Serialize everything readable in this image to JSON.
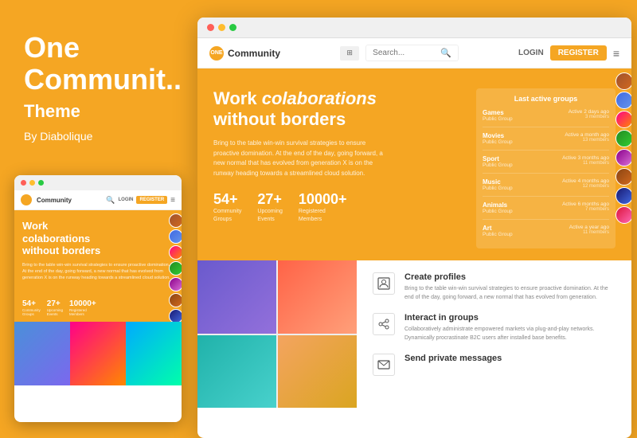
{
  "left": {
    "title_line1": "One",
    "title_line2": "Communit..",
    "subtitle": "Theme",
    "by": "By Diabolique"
  },
  "browser": {
    "dots": [
      "red",
      "yellow",
      "green"
    ]
  },
  "nav": {
    "logo_initial": "ONE",
    "logo_text": "Community",
    "search_placeholder": "Search...",
    "login": "LOGIN",
    "register": "REGISTER"
  },
  "hero": {
    "title_bold": "Work",
    "title_italic": "colaborations",
    "title_line2": "without borders",
    "description": "Bring to the table win-win survival strategies to ensure proactive domination. At the end of the day, going forward, a new normal that has evolved from generation X is on the runway heading towards a streamlined cloud solution.",
    "stats": [
      {
        "num": "54+",
        "label_line1": "Community",
        "label_line2": "Groups"
      },
      {
        "num": "27+",
        "label_line1": "Upcoming",
        "label_line2": "Events"
      },
      {
        "num": "10000+",
        "label_line1": "Registered",
        "label_line2": "Members"
      }
    ]
  },
  "groups_panel": {
    "title": "Last active groups",
    "groups": [
      {
        "name": "Games",
        "type": "Public Group",
        "activity": "Active 2 days ago",
        "members": "3 members"
      },
      {
        "name": "Movies",
        "type": "Public Group",
        "activity": "Active a month ago",
        "members": "13 members"
      },
      {
        "name": "Sport",
        "type": "Public Group",
        "activity": "Active 3 months ago",
        "members": "11 members"
      },
      {
        "name": "Music",
        "type": "Public Group",
        "activity": "Active 4 months ago",
        "members": "12 members"
      },
      {
        "name": "Animals",
        "type": "Public Group",
        "activity": "Active 6 months ago",
        "members": "7 members"
      },
      {
        "name": "Art",
        "type": "Public Group",
        "activity": "Active a year ago",
        "members": "11 members"
      }
    ]
  },
  "features": [
    {
      "icon": "👤",
      "title": "Create profiles",
      "desc": "Bring to the table win-win survival strategies to ensure proactive domination. At the end of the day, going forward, a new normal that has evolved from generation."
    },
    {
      "icon": "🔗",
      "title": "Interact in groups",
      "desc": "Collaboratively administrate empowered markets via plug-and-play networks. Dynamically procrastinate B2C users after installed base benefits."
    },
    {
      "icon": "✉",
      "title": "Send private messages",
      "desc": ""
    }
  ],
  "mobile": {
    "logo_text": "Community",
    "login": "LOGIN",
    "register": "REGISTER",
    "hero_title_line1": "Work",
    "hero_title_line2": "colaborations",
    "hero_title_line3": "without borders",
    "hero_desc": "Bring to the table win-win survival strategies to ensure proactive domination. At the end of the day, going forward, a new normal that has evolved from generation X is on the runway heading towards a streamlined cloud solution.",
    "stats": [
      {
        "num": "54+",
        "label": "Community\nGroups"
      },
      {
        "num": "27+",
        "label": "Upcoming\nEvents"
      },
      {
        "num": "10000+",
        "label": "Registered\nMembers"
      }
    ]
  }
}
